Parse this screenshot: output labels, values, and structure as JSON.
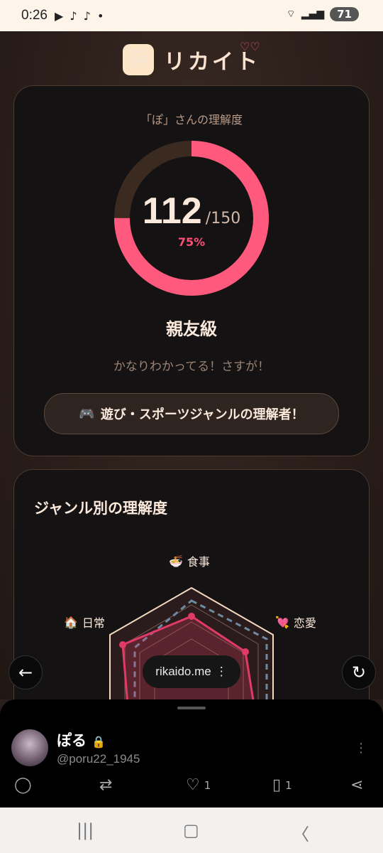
{
  "status": {
    "time": "0:26",
    "battery": "71"
  },
  "app": {
    "name": "リカイト"
  },
  "score": {
    "label": "「ぽ」さんの理解度",
    "value": "112",
    "max": "/150",
    "percent_text": "75%",
    "percent": 75,
    "rank": "親友級",
    "comment": "かなりわかってる！さすが！",
    "badge": "遊び・スポーツジャンルの理解者！",
    "badge_icon": "🎮"
  },
  "genre": {
    "title": "ジャンル別の理解度",
    "axes": [
      {
        "icon": "🍜",
        "label": "食事"
      },
      {
        "icon": "💘",
        "label": "恋愛"
      },
      {
        "icon": "🏠",
        "label": "日常"
      }
    ]
  },
  "browser": {
    "url": "rikaido.me"
  },
  "tweet": {
    "user": "ぽる",
    "handle": "@poru22_1945",
    "likes": "1",
    "bookmarks": "1"
  },
  "colors": {
    "accent": "#ff5a7e",
    "track": "#3a2a20"
  }
}
